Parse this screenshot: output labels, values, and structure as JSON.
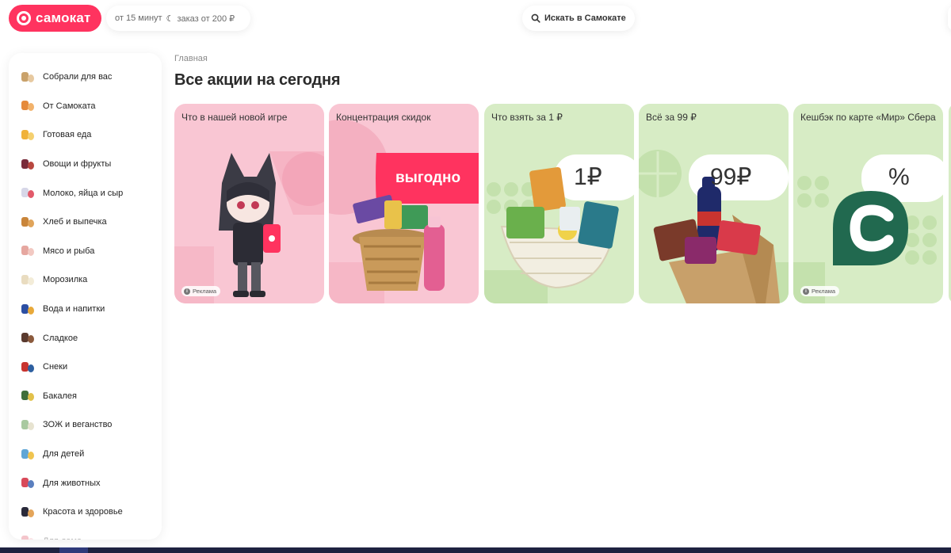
{
  "header": {
    "logo_text": "самокат",
    "delivery_time": "от 15 минут",
    "min_order": "заказ от 200 ₽",
    "search_label": "Искать в Самокате"
  },
  "sidebar": {
    "items": [
      {
        "label": "Собрали для вас",
        "icon": "collection-icon",
        "c1": "#c9a26b",
        "c2": "#e7c9a0"
      },
      {
        "label": "От Самоката",
        "icon": "samokat-brand-icon",
        "c1": "#e58a3b",
        "c2": "#f2b26b"
      },
      {
        "label": "Готовая еда",
        "icon": "ready-food-icon",
        "c1": "#f0b23a",
        "c2": "#f5d06f"
      },
      {
        "label": "Овощи и фрукты",
        "icon": "vegetables-icon",
        "c1": "#7a2c3b",
        "c2": "#b8473f"
      },
      {
        "label": "Молоко, яйца и сыр",
        "icon": "dairy-icon",
        "c1": "#d7d7e8",
        "c2": "#e25a6a"
      },
      {
        "label": "Хлеб и выпечка",
        "icon": "bread-icon",
        "c1": "#c9853a",
        "c2": "#e0a45a"
      },
      {
        "label": "Мясо и рыба",
        "icon": "meat-icon",
        "c1": "#e6a7a0",
        "c2": "#f2c9c2"
      },
      {
        "label": "Морозилка",
        "icon": "frozen-icon",
        "c1": "#e9dcc0",
        "c2": "#f3ecd8"
      },
      {
        "label": "Вода и напитки",
        "icon": "drinks-icon",
        "c1": "#2c4fa3",
        "c2": "#e8a93a"
      },
      {
        "label": "Сладкое",
        "icon": "sweets-icon",
        "c1": "#5a3a2e",
        "c2": "#8b5a3c"
      },
      {
        "label": "Снеки",
        "icon": "snacks-icon",
        "c1": "#c8342f",
        "c2": "#2d5fa0"
      },
      {
        "label": "Бакалея",
        "icon": "grocery-icon",
        "c1": "#3f6e3a",
        "c2": "#e2c14a"
      },
      {
        "label": "ЗОЖ и веганство",
        "icon": "healthy-icon",
        "c1": "#a9c9a0",
        "c2": "#e7e3d0"
      },
      {
        "label": "Для детей",
        "icon": "kids-icon",
        "c1": "#5fa6d6",
        "c2": "#f0c44f"
      },
      {
        "label": "Для животных",
        "icon": "pets-icon",
        "c1": "#d94a5a",
        "c2": "#5a7fbf"
      },
      {
        "label": "Красота и здоровье",
        "icon": "beauty-icon",
        "c1": "#2a2a3a",
        "c2": "#e4a55a"
      },
      {
        "label": "Для дома",
        "icon": "home-goods-icon",
        "c1": "#e05a6a",
        "c2": "#f2b0b8"
      }
    ]
  },
  "main": {
    "breadcrumb": "Главная",
    "title": "Все акции на сегодня",
    "ad_label": "Реклама",
    "cards": [
      {
        "title": "Что в нашей новой игре",
        "theme": "pink"
      },
      {
        "title": "Концентрация скидок",
        "theme": "pink",
        "promo": "выгодно"
      },
      {
        "title": "Что взять за 1 ₽",
        "theme": "green",
        "promo": "1₽"
      },
      {
        "title": "Всё за 99 ₽",
        "theme": "green",
        "promo": "99₽"
      },
      {
        "title": "Кешбэк по карте «Мир» Сбера",
        "theme": "green",
        "promo": "%"
      }
    ]
  },
  "colors": {
    "brand": "#ff335f",
    "pink_card": "#f9c6d3",
    "green_card": "#d7ecc5",
    "sber_green": "#21694f"
  }
}
